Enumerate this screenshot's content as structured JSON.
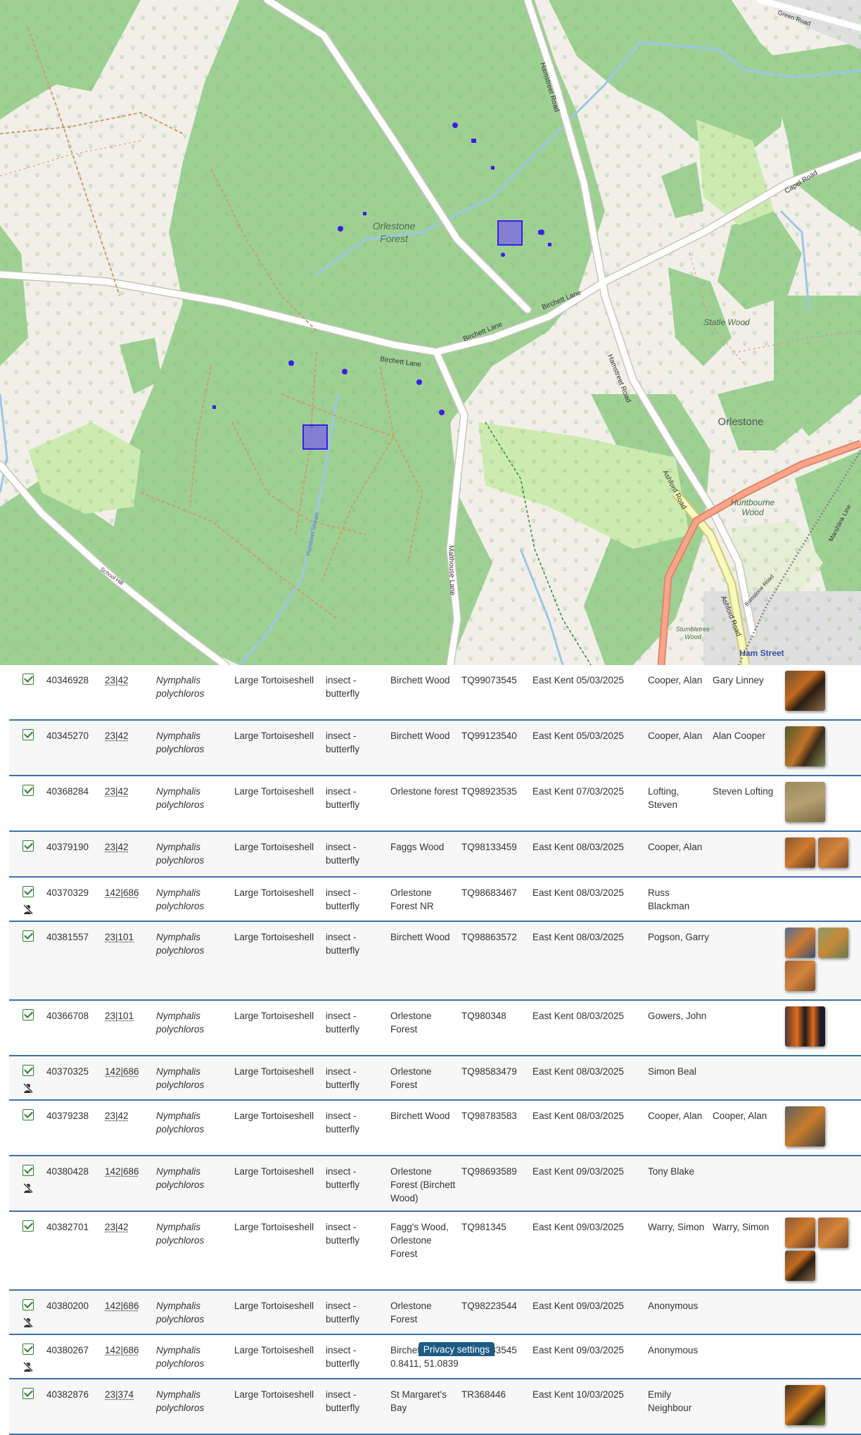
{
  "map": {
    "labels": {
      "forest": [
        "Orlestone",
        "Forest"
      ],
      "birchett_lane": "Birchett Lane",
      "hamstreet_road": "Hamstreet Road",
      "capel_road": "Capel Road",
      "ashford_road": "Ashford Road",
      "mathouse_lane": "Malthouse Lane",
      "school_hill": "School Hill",
      "statle_wood": "Statle Wood",
      "orlestone": "Orlestone",
      "huntbourne": [
        "Huntbourne",
        "Wood"
      ],
      "stumbletree": [
        "Stumbletree",
        "Wood"
      ],
      "ham_street": "Ham Street",
      "green_road": "Green Road",
      "marshlink": "Marshlink Line",
      "brimstone": "Brimstone Road",
      "stream": "Hunstreet Stream"
    },
    "colors": {
      "forest": "#9ed094",
      "land": "#f2efe9",
      "marker": "#3b1ee6"
    }
  },
  "rows": [
    {
      "id": "40346928",
      "group": "23|42",
      "sci": [
        "Nymphalis",
        "polychloros"
      ],
      "common": "Large Tortoiseshell",
      "type": [
        "insect -",
        "butterfly"
      ],
      "site": [
        "Birchett Wood"
      ],
      "ref": "TQ99073545",
      "vc": "East Kent",
      "date": "05/03/2025",
      "recorder": [
        "Cooper, Alan"
      ],
      "determiner": [
        "Gary Linney"
      ],
      "photos": [
        "ph-1"
      ],
      "anon": false
    },
    {
      "id": "40345270",
      "group": "23|42",
      "sci": [
        "Nymphalis",
        "polychloros"
      ],
      "common": "Large Tortoiseshell",
      "type": [
        "insect -",
        "butterfly"
      ],
      "site": [
        "Birchett Wood"
      ],
      "ref": "TQ99123540",
      "vc": "East Kent",
      "date": "05/03/2025",
      "recorder": [
        "Cooper, Alan"
      ],
      "determiner": [
        "Alan Cooper"
      ],
      "photos": [
        "ph-2"
      ],
      "anon": false
    },
    {
      "id": "40368284",
      "group": "23|42",
      "sci": [
        "Nymphalis",
        "polychloros"
      ],
      "common": "Large Tortoiseshell",
      "type": [
        "insect -",
        "butterfly"
      ],
      "site": [
        "Orlestone forest"
      ],
      "ref": "TQ98923535",
      "vc": "East Kent",
      "date": "07/03/2025",
      "recorder": [
        "Lofting,",
        "Steven"
      ],
      "determiner": [
        "Steven Lofting"
      ],
      "photos": [
        "ph-3"
      ],
      "anon": false
    },
    {
      "id": "40379190",
      "group": "23|42",
      "sci": [
        "Nymphalis",
        "polychloros"
      ],
      "common": "Large Tortoiseshell",
      "type": [
        "insect -",
        "butterfly"
      ],
      "site": [
        "Faggs Wood"
      ],
      "ref": "TQ98133459",
      "vc": "East Kent",
      "date": "08/03/2025",
      "recorder": [
        "Cooper, Alan"
      ],
      "determiner": [],
      "photos": [
        "ph-4",
        "ph-9"
      ],
      "photo_small": true,
      "anon": false
    },
    {
      "id": "40370329",
      "group": "142|686",
      "sci": [
        "Nymphalis",
        "polychloros"
      ],
      "common": "Large Tortoiseshell",
      "type": [
        "insect -",
        "butterfly"
      ],
      "site": [
        "Orlestone",
        "Forest NR"
      ],
      "ref": "TQ98683467",
      "vc": "East Kent",
      "date": "08/03/2025",
      "recorder": [
        "Russ",
        "Blackman"
      ],
      "determiner": [],
      "photos": [],
      "anon": true
    },
    {
      "id": "40381557",
      "group": "23|101",
      "sci": [
        "Nymphalis",
        "polychloros"
      ],
      "common": "Large Tortoiseshell",
      "type": [
        "insect -",
        "butterfly"
      ],
      "site": [
        "Birchett Wood"
      ],
      "ref": "TQ98863572",
      "vc": "East Kent",
      "date": "08/03/2025",
      "recorder": [
        "Pogson, Garry"
      ],
      "determiner": [],
      "photos": [
        "ph-5",
        "ph-6",
        "ph-9"
      ],
      "photo_small": true,
      "anon": false
    },
    {
      "id": "40366708",
      "group": "23|101",
      "sci": [
        "Nymphalis",
        "polychloros"
      ],
      "common": "Large Tortoiseshell",
      "type": [
        "insect -",
        "butterfly"
      ],
      "site": [
        "Orlestone",
        "Forest"
      ],
      "ref": "TQ980348",
      "vc": "East Kent",
      "date": "08/03/2025",
      "recorder": [
        "Gowers, John"
      ],
      "determiner": [],
      "photos": [
        "ph-7"
      ],
      "anon": false
    },
    {
      "id": "40370325",
      "group": "142|686",
      "sci": [
        "Nymphalis",
        "polychloros"
      ],
      "common": "Large Tortoiseshell",
      "type": [
        "insect -",
        "butterfly"
      ],
      "site": [
        "Orlestone",
        "Forest"
      ],
      "ref": "TQ98583479",
      "vc": "East Kent",
      "date": "08/03/2025",
      "recorder": [
        "Simon Beal"
      ],
      "determiner": [],
      "photos": [],
      "anon": true
    },
    {
      "id": "40379238",
      "group": "23|42",
      "sci": [
        "Nymphalis",
        "polychloros"
      ],
      "common": "Large Tortoiseshell",
      "type": [
        "insect -",
        "butterfly"
      ],
      "site": [
        "Birchett Wood"
      ],
      "ref": "TQ98783583",
      "vc": "East Kent",
      "date": "08/03/2025",
      "recorder": [
        "Cooper, Alan"
      ],
      "determiner": [
        "Cooper, Alan"
      ],
      "photos": [
        "ph-8"
      ],
      "anon": false
    },
    {
      "id": "40380428",
      "group": "142|686",
      "sci": [
        "Nymphalis",
        "polychloros"
      ],
      "common": "Large Tortoiseshell",
      "type": [
        "insect -",
        "butterfly"
      ],
      "site": [
        "Orlestone",
        "Forest (Birchett",
        "Wood)"
      ],
      "ref": "TQ98693589",
      "vc": "East Kent",
      "date": "09/03/2025",
      "recorder": [
        "Tony Blake"
      ],
      "determiner": [],
      "photos": [],
      "anon": true
    },
    {
      "id": "40382701",
      "group": "23|42",
      "sci": [
        "Nymphalis",
        "polychloros"
      ],
      "common": "Large Tortoiseshell",
      "type": [
        "insect -",
        "butterfly"
      ],
      "site": [
        "Fagg's Wood,",
        "Orlestone",
        "Forest"
      ],
      "ref": "TQ981345",
      "vc": "East Kent",
      "date": "09/03/2025",
      "recorder": [
        "Warry, Simon"
      ],
      "determiner": [
        "Warry, Simon"
      ],
      "photos": [
        "ph-4",
        "ph-9",
        "ph-1"
      ],
      "photo_small": true,
      "anon": false
    },
    {
      "id": "40380200",
      "group": "142|686",
      "sci": [
        "Nymphalis",
        "polychloros"
      ],
      "common": "Large Tortoiseshell",
      "type": [
        "insect -",
        "butterfly"
      ],
      "site": [
        "Orlestone",
        "Forest"
      ],
      "ref": "TQ98223544",
      "vc": "East Kent",
      "date": "09/03/2025",
      "recorder": [
        "Anonymous"
      ],
      "determiner": [],
      "photos": [],
      "anon": true
    },
    {
      "id": "40380267",
      "group": "142|686",
      "sci": [
        "Nymphalis",
        "polychloros"
      ],
      "common": "Large Tortoiseshell",
      "type": [
        "insect -",
        "butterfly"
      ],
      "site": [
        "Birchett Wood",
        "0.8411, 51.0839"
      ],
      "ref": "TQ99083545",
      "vc": "East Kent",
      "date": "09/03/2025",
      "recorder": [
        "Anonymous"
      ],
      "determiner": [],
      "photos": [],
      "anon": true
    },
    {
      "id": "40382876",
      "group": "23|374",
      "sci": [
        "Nymphalis",
        "polychloros"
      ],
      "common": "Large Tortoiseshell",
      "type": [
        "insect -",
        "butterfly"
      ],
      "site": [
        "St Margaret's",
        "Bay"
      ],
      "ref": "TR368446",
      "vc": "East Kent",
      "date": "10/03/2025",
      "recorder": [
        "Emily",
        "Neighbour"
      ],
      "determiner": [],
      "photos": [
        "ph-10"
      ],
      "anon": false
    }
  ],
  "privacy": {
    "label": "Privacy settings"
  }
}
